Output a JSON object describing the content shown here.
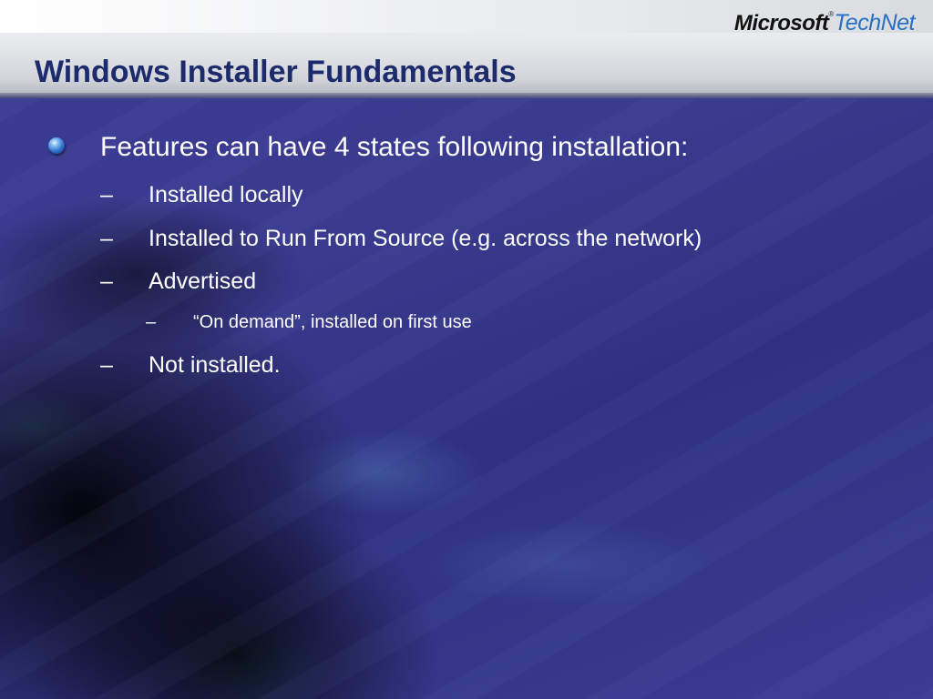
{
  "header": {
    "logo_microsoft": "Microsoft",
    "logo_trademark": "®",
    "logo_technet": "TechNet",
    "title": "Windows Installer Fundamentals"
  },
  "body": {
    "main_point": "Features can have 4 states following installation:",
    "dash_symbol": "–",
    "states": [
      "Installed locally",
      "Installed to Run From Source (e.g. across the network)",
      "Advertised",
      "Not installed."
    ],
    "advertised_detail": "“On demand”, installed on first use"
  },
  "colors": {
    "title": "#1d2a6b",
    "body_text": "#ffffff",
    "background": "#3a3a8c",
    "technet": "#2a6fc4"
  },
  "icons": {
    "bullet": "blue-sphere-bullet-icon"
  }
}
